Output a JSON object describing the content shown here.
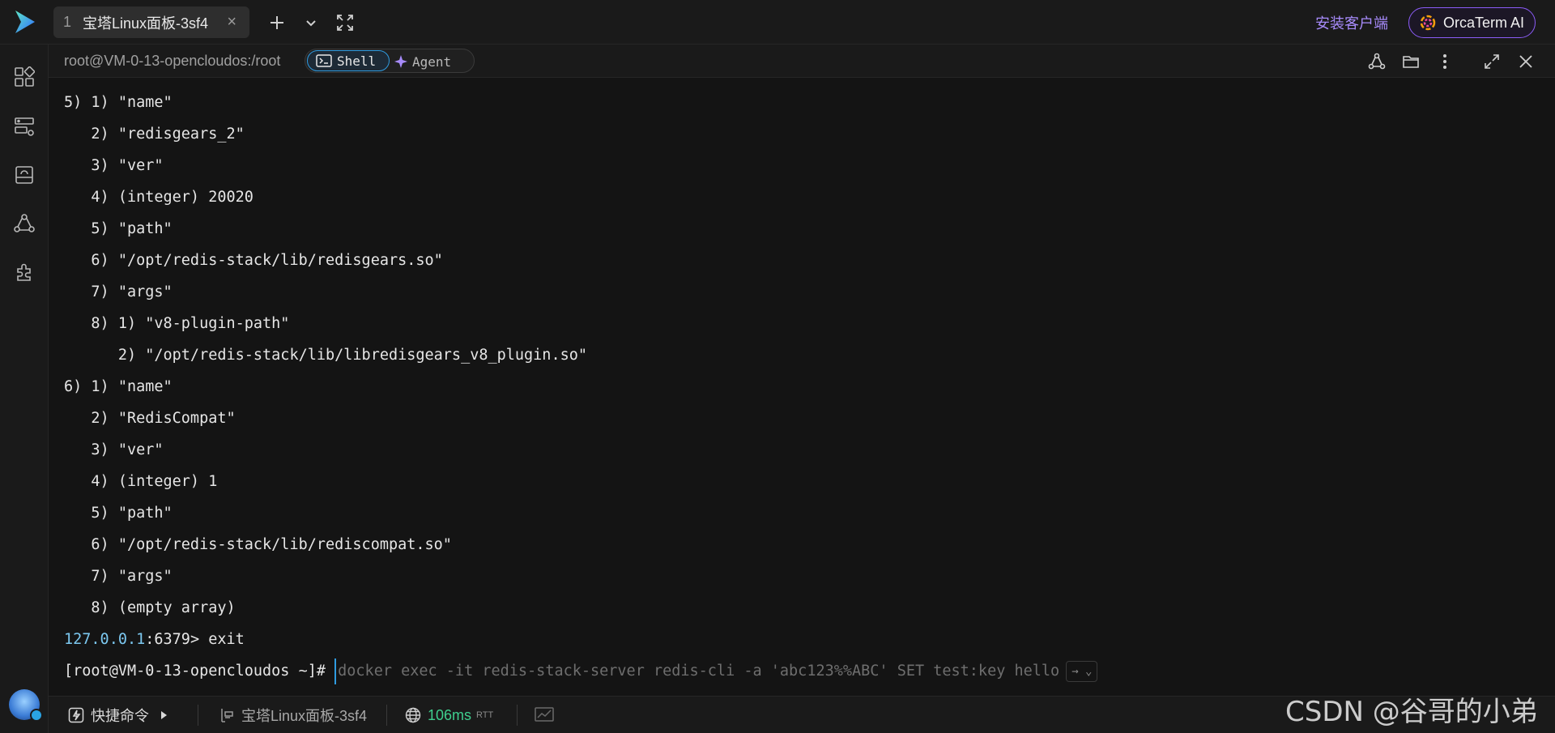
{
  "tab": {
    "number": "1",
    "title": "宝塔Linux面板-3sf4",
    "close_glyph": "×"
  },
  "topbar": {
    "install_label": "安装客户端",
    "ai_label": "OrcaTerm AI"
  },
  "session": {
    "host_path": "root@VM-0-13-opencloudos:/root",
    "modes": {
      "shell": "Shell",
      "agent": "Agent"
    }
  },
  "terminal": {
    "lines": [
      "5) 1) \"name\"",
      "   2) \"redisgears_2\"",
      "   3) \"ver\"",
      "   4) (integer) 20020",
      "   5) \"path\"",
      "   6) \"/opt/redis-stack/lib/redisgears.so\"",
      "   7) \"args\"",
      "   8) 1) \"v8-plugin-path\"",
      "      2) \"/opt/redis-stack/lib/libredisgears_v8_plugin.so\"",
      "6) 1) \"name\"",
      "   2) \"RedisCompat\"",
      "   3) \"ver\"",
      "   4) (integer) 1",
      "   5) \"path\"",
      "   6) \"/opt/redis-stack/lib/rediscompat.so\"",
      "   7) \"args\"",
      "   8) (empty array)"
    ],
    "exit_ip": "127.0.0.1",
    "exit_rest": ":6379> exit",
    "prompt": "[root@VM-0-13-opencloudos ~]# ",
    "suggestion": "docker exec -it redis-stack-server redis-cli -a 'abc123%%ABC' SET test:key hello",
    "accept_hint": "→ ⌄"
  },
  "statusbar": {
    "quick_commands": "快捷命令",
    "server_name": "宝塔Linux面板-3sf4",
    "latency": "106ms",
    "rtt_label": "RTT"
  },
  "watermark": "CSDN @谷哥的小弟",
  "colors": {
    "accent_blue": "#2f9be0",
    "accent_purple": "#8b5cf6",
    "latency_green": "#3ecf8e",
    "ip_blue": "#7cc8f0"
  },
  "icons": {
    "sidebar": [
      "dashboard-grid-icon",
      "server-list-icon",
      "storage-icon",
      "network-icon",
      "plugin-icon"
    ],
    "header": [
      "share-icon",
      "folder-icon",
      "more-icon",
      "expand-icon",
      "close-icon"
    ]
  }
}
